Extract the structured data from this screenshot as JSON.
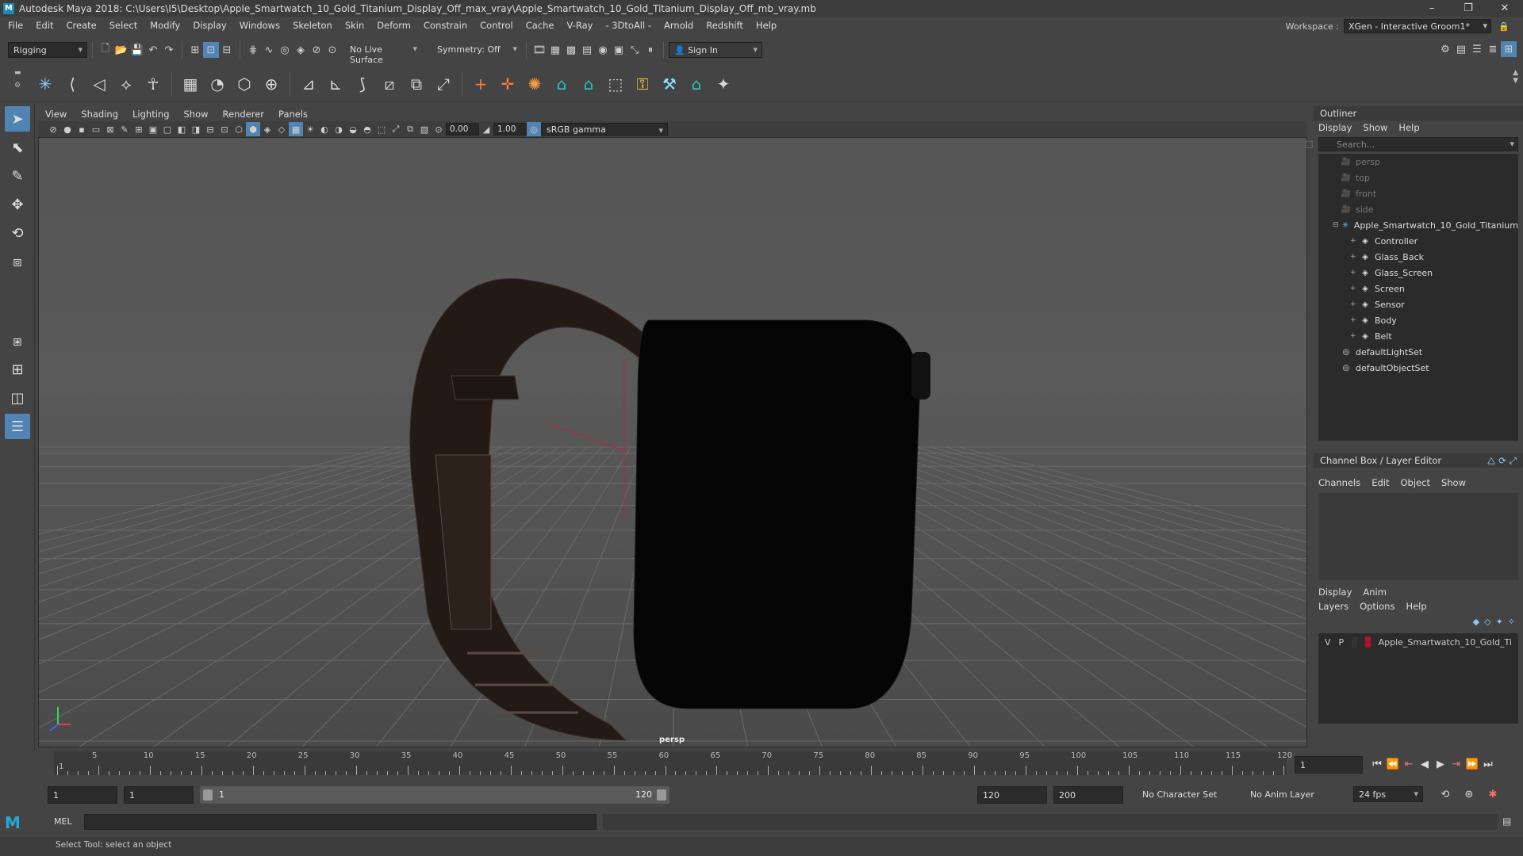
{
  "window": {
    "title": "Autodesk Maya 2018: C:\\Users\\I5\\Desktop\\Apple_Smartwatch_10_Gold_Titanium_Display_Off_max_vray\\Apple_Smartwatch_10_Gold_Titanium_Display_Off_mb_vray.mb",
    "app_icon": "M",
    "minimize": "–",
    "maximize": "❐",
    "close": "✕"
  },
  "menubar": {
    "items": [
      "File",
      "Edit",
      "Create",
      "Select",
      "Modify",
      "Display",
      "Windows",
      "Skeleton",
      "Skin",
      "Deform",
      "Constrain",
      "Control",
      "Cache",
      "V-Ray",
      "- 3DtoAll -",
      "Arnold",
      "Redshift",
      "Help"
    ],
    "workspace_label": "Workspace :",
    "workspace_value": "XGen - Interactive Groom1*"
  },
  "statusline": {
    "mode": "Rigging",
    "live_surface": "No Live Surface",
    "symmetry": "Symmetry: Off",
    "sign_in": "Sign In"
  },
  "viewport": {
    "menus": [
      "View",
      "Shading",
      "Lighting",
      "Show",
      "Renderer",
      "Panels"
    ],
    "exposure": "0.00",
    "gamma": "1.00",
    "colorspace": "sRGB gamma",
    "camera_label": "persp"
  },
  "outliner": {
    "title": "Outliner",
    "menus": [
      "Display",
      "Show",
      "Help"
    ],
    "search_placeholder": "Search...",
    "items": [
      {
        "label": "persp",
        "dim": true
      },
      {
        "label": "top",
        "dim": true
      },
      {
        "label": "front",
        "dim": true
      },
      {
        "label": "side",
        "dim": true
      },
      {
        "label": "Apple_Smartwatch_10_Gold_Titanium",
        "dim": false
      },
      {
        "label": "Controller",
        "dim": false
      },
      {
        "label": "Glass_Back",
        "dim": false
      },
      {
        "label": "Glass_Screen",
        "dim": false
      },
      {
        "label": "Screen",
        "dim": false
      },
      {
        "label": "Sensor",
        "dim": false
      },
      {
        "label": "Body",
        "dim": false
      },
      {
        "label": "Belt",
        "dim": false
      },
      {
        "label": "defaultLightSet",
        "dim": false
      },
      {
        "label": "defaultObjectSet",
        "dim": false
      }
    ]
  },
  "channelbox": {
    "title": "Channel Box / Layer Editor",
    "menus": [
      "Channels",
      "Edit",
      "Object",
      "Show"
    ],
    "layer_tabs": [
      "Display",
      "Anim"
    ],
    "layer_menus": [
      "Layers",
      "Options",
      "Help"
    ],
    "layer": {
      "v": "V",
      "p": "P",
      "name": "Apple_Smartwatch_10_Gold_Ti",
      "color": "#b0112a"
    }
  },
  "timeline": {
    "ticks": [
      "5",
      "10",
      "15",
      "20",
      "25",
      "30",
      "35",
      "40",
      "45",
      "50",
      "55",
      "60",
      "65",
      "70",
      "75",
      "80",
      "85",
      "90",
      "95",
      "100",
      "105",
      "110",
      "115",
      "120"
    ],
    "first_tick": "1",
    "current_frame": "1"
  },
  "range": {
    "start": "1",
    "playback_start": "1",
    "slider_start": "1",
    "slider_end": "120",
    "playback_end": "120",
    "end": "200",
    "character_set": "No Character Set",
    "anim_layer": "No Anim Layer",
    "fps": "24 fps"
  },
  "command": {
    "mel_label": "MEL",
    "help_text": "Select Tool: select an object"
  },
  "colors": {
    "accent": "#5284b3",
    "background": "#444444"
  }
}
